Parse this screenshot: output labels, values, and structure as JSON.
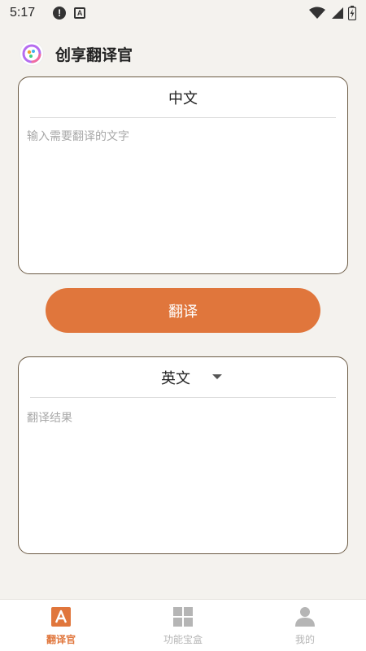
{
  "status_bar": {
    "time": "5:17",
    "alert_icon": "exclamation-circle-icon",
    "a_icon": "A"
  },
  "app": {
    "title": "创享翻译官"
  },
  "source": {
    "language": "中文",
    "placeholder": "输入需要翻译的文字"
  },
  "actions": {
    "translate_label": "翻译"
  },
  "target": {
    "language": "英文",
    "result_placeholder": "翻译结果"
  },
  "bottom_nav": {
    "items": [
      {
        "label": "翻译官",
        "icon": "translate-icon",
        "active": true
      },
      {
        "label": "功能宝盒",
        "icon": "grid-icon",
        "active": false
      },
      {
        "label": "我的",
        "icon": "user-icon",
        "active": false
      }
    ]
  },
  "colors": {
    "accent": "#e0763c",
    "background": "#f4f2ee",
    "card_border": "#6b5a44",
    "inactive": "#b5b5b5"
  }
}
